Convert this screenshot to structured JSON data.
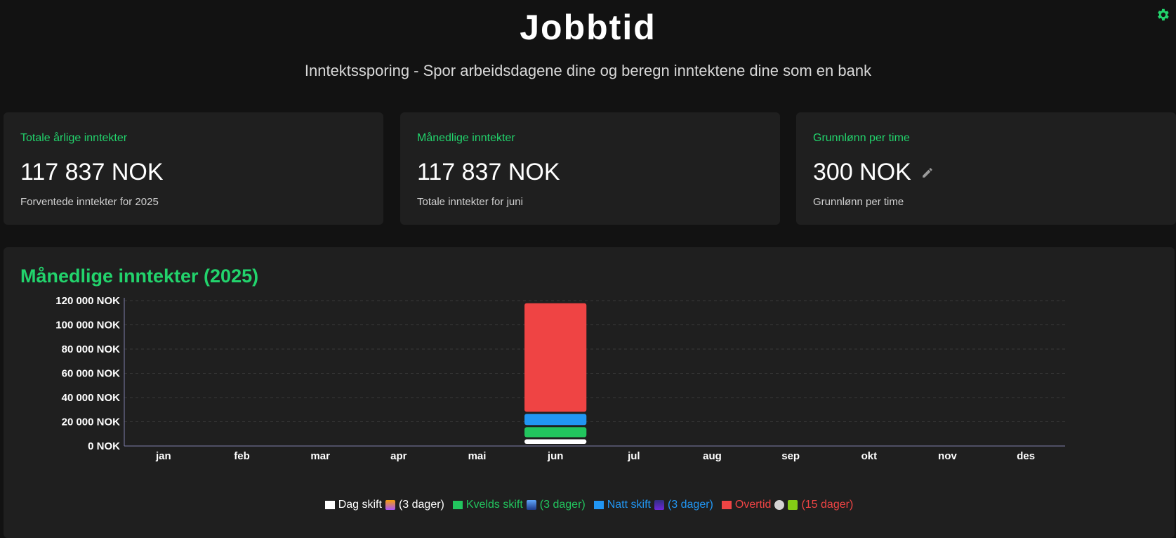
{
  "header": {
    "title": "Jobbtid",
    "subtitle": "Inntektssporing - Spor arbeidsdagene dine og beregn inntektene dine som en bank",
    "settings_icon": "gear-icon",
    "accent_color": "#22d36c"
  },
  "cards": [
    {
      "label": "Totale årlige inntekter",
      "value": "117 837 NOK",
      "desc": "Forventede inntekter for 2025"
    },
    {
      "label": "Månedlige inntekter",
      "value": "117 837 NOK",
      "desc": "Totale inntekter for juni"
    },
    {
      "label": "Grunnlønn per time",
      "value": "300 NOK",
      "desc": "Grunnlønn per time",
      "edit_icon": "pencil-icon"
    }
  ],
  "chart_data": {
    "type": "bar",
    "stacked": true,
    "title": "Månedlige inntekter (2025)",
    "categories": [
      "jan",
      "feb",
      "mar",
      "apr",
      "mai",
      "jun",
      "jul",
      "aug",
      "sep",
      "okt",
      "nov",
      "des"
    ],
    "y_ticks": [
      "0 NOK",
      "20 000 NOK",
      "40 000 NOK",
      "60 000 NOK",
      "80 000 NOK",
      "100 000 NOK",
      "120 000 NOK"
    ],
    "ylim": [
      0,
      120000
    ],
    "grid": true,
    "legend_position": "bottom",
    "series": [
      {
        "name": "Dag skift",
        "legend_suffix": "(3 dager)",
        "color": "#ffffff",
        "values": [
          0,
          0,
          0,
          0,
          0,
          5500,
          0,
          0,
          0,
          0,
          0,
          0
        ]
      },
      {
        "name": "Kvelds skift",
        "legend_suffix": "(3 dager)",
        "color": "#22c55e",
        "values": [
          0,
          0,
          0,
          0,
          0,
          10000,
          0,
          0,
          0,
          0,
          0,
          0
        ]
      },
      {
        "name": "Natt skift",
        "legend_suffix": "(3 dager)",
        "color": "#2196f3",
        "values": [
          0,
          0,
          0,
          0,
          0,
          11000,
          0,
          0,
          0,
          0,
          0,
          0
        ]
      },
      {
        "name": "Overtid",
        "legend_suffix": "(15 dager)",
        "color": "#ef4444",
        "values": [
          0,
          0,
          0,
          0,
          0,
          91337,
          0,
          0,
          0,
          0,
          0,
          0
        ]
      }
    ]
  }
}
